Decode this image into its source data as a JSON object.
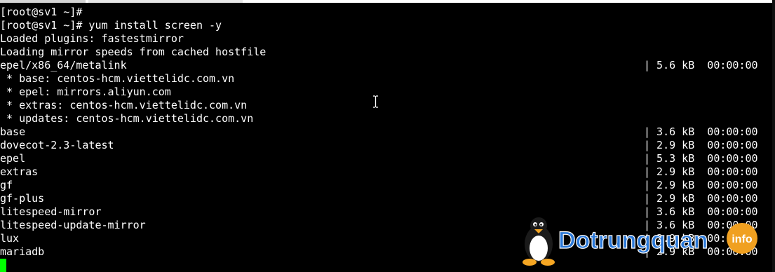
{
  "terminal": {
    "lines": [
      {
        "left": "[root@sv1 ~]#",
        "right": ""
      },
      {
        "left": "[root@sv1 ~]# yum install screen -y",
        "right": ""
      },
      {
        "left": "Loaded plugins: fastestmirror",
        "right": ""
      },
      {
        "left": "Loading mirror speeds from cached hostfile",
        "right": ""
      },
      {
        "left": "epel/x86_64/metalink",
        "right": "| 5.6 kB  00:00:00"
      },
      {
        "left": " * base: centos-hcm.viettelidc.com.vn",
        "right": ""
      },
      {
        "left": " * epel: mirrors.aliyun.com",
        "right": ""
      },
      {
        "left": " * extras: centos-hcm.viettelidc.com.vn",
        "right": ""
      },
      {
        "left": " * updates: centos-hcm.viettelidc.com.vn",
        "right": ""
      },
      {
        "left": "base",
        "right": "| 3.6 kB  00:00:00"
      },
      {
        "left": "dovecot-2.3-latest",
        "right": "| 2.9 kB  00:00:00"
      },
      {
        "left": "epel",
        "right": "| 5.3 kB  00:00:00"
      },
      {
        "left": "extras",
        "right": "| 2.9 kB  00:00:00"
      },
      {
        "left": "gf",
        "right": "| 2.9 kB  00:00:00"
      },
      {
        "left": "gf-plus",
        "right": "| 2.9 kB  00:00:00"
      },
      {
        "left": "litespeed-mirror",
        "right": "| 3.6 kB  00:00:00"
      },
      {
        "left": "litespeed-update-mirror",
        "right": "| 3.6 kB  00:00:00"
      },
      {
        "left": "lux",
        "right": "| 2.9 kB  00:00:00"
      },
      {
        "left": "mariadb",
        "right": "| 2.9 kB  00:00:00"
      }
    ]
  },
  "watermark": {
    "brand": "Dotrungquan",
    "suffix": "info"
  },
  "colors": {
    "background": "#000000",
    "text": "#ffffff",
    "cursor": "#00ff00",
    "brand_blue": "#2a78d8",
    "brand_orange": "#f0a020"
  }
}
